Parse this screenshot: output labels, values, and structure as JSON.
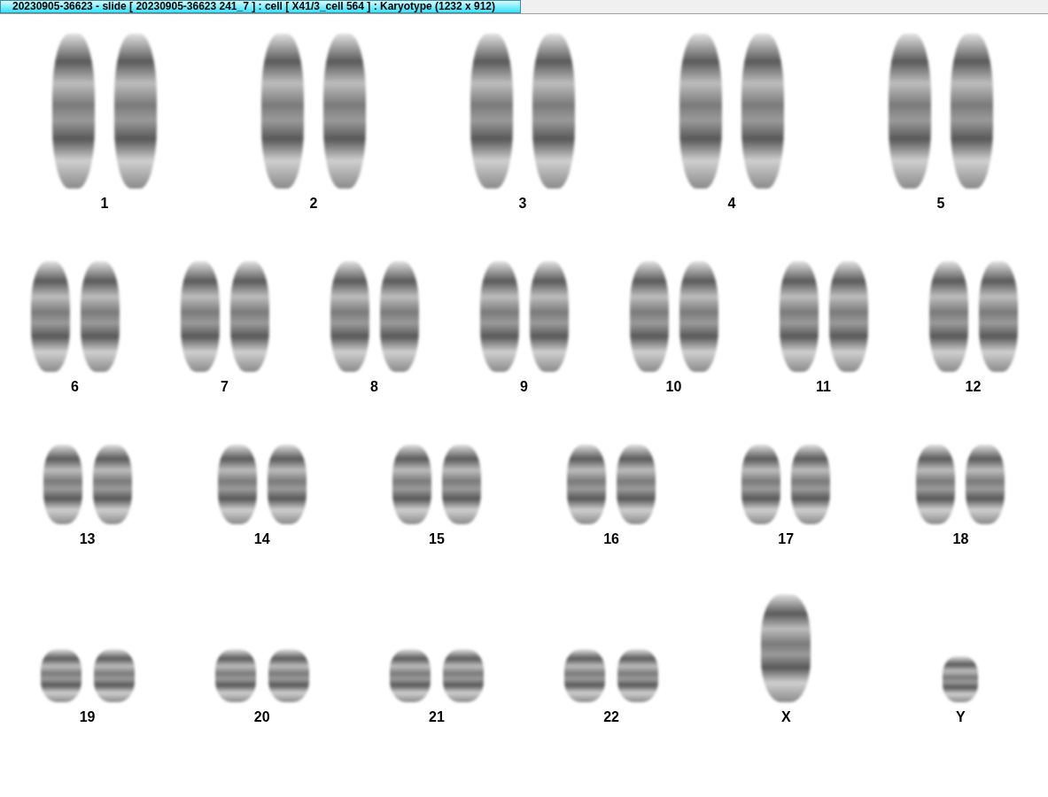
{
  "window": {
    "title": "20230905-36623 - slide [ 20230905-36623 241_7 ] : cell [ X41/3_cell 564 ] : Karyotype  (1232 x 912)"
  },
  "karyotype": {
    "rows": [
      [
        {
          "label": "1",
          "kind": "pair"
        },
        {
          "label": "2",
          "kind": "pair"
        },
        {
          "label": "3",
          "kind": "pair"
        },
        {
          "label": "4",
          "kind": "pair"
        },
        {
          "label": "5",
          "kind": "pair"
        }
      ],
      [
        {
          "label": "6",
          "kind": "pair"
        },
        {
          "label": "7",
          "kind": "pair"
        },
        {
          "label": "8",
          "kind": "pair"
        },
        {
          "label": "9",
          "kind": "pair"
        },
        {
          "label": "10",
          "kind": "pair"
        },
        {
          "label": "11",
          "kind": "pair"
        },
        {
          "label": "12",
          "kind": "pair"
        }
      ],
      [
        {
          "label": "13",
          "kind": "pair"
        },
        {
          "label": "14",
          "kind": "pair"
        },
        {
          "label": "15",
          "kind": "pair"
        },
        {
          "label": "16",
          "kind": "pair"
        },
        {
          "label": "17",
          "kind": "pair"
        },
        {
          "label": "18",
          "kind": "pair"
        }
      ],
      [
        {
          "label": "19",
          "kind": "pair"
        },
        {
          "label": "20",
          "kind": "pair"
        },
        {
          "label": "21",
          "kind": "pair"
        },
        {
          "label": "22",
          "kind": "pair"
        },
        {
          "label": "X",
          "kind": "tall"
        },
        {
          "label": "Y",
          "kind": "short"
        }
      ]
    ]
  }
}
